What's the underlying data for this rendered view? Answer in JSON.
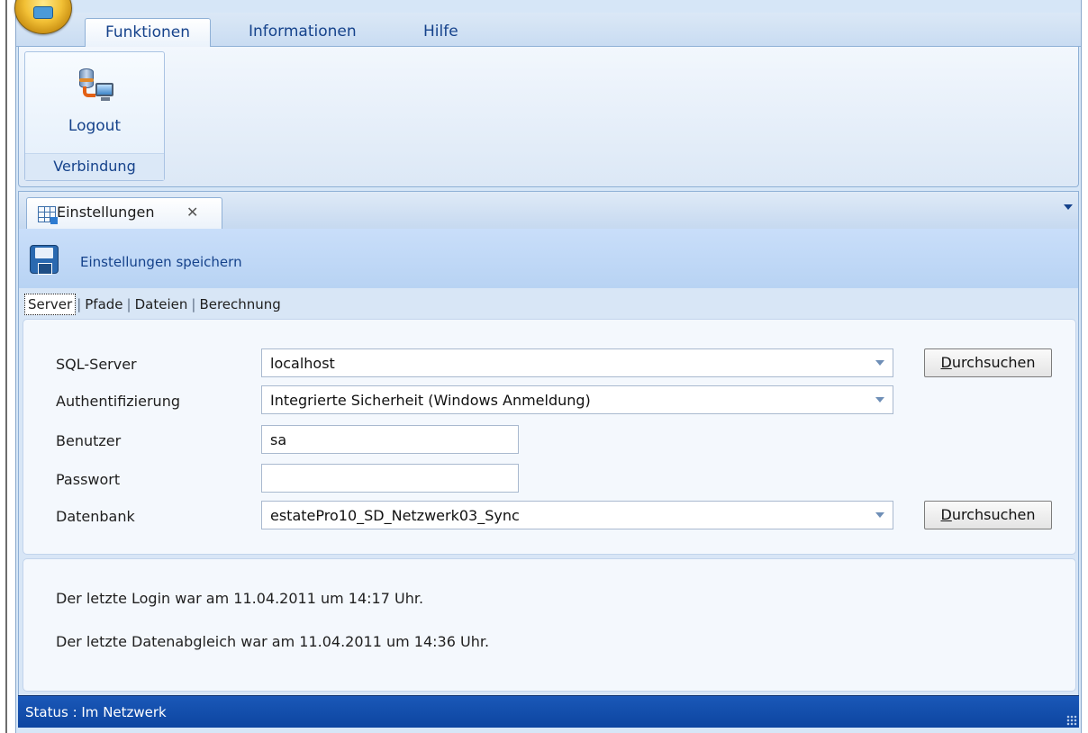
{
  "ribbon": {
    "tabs": [
      "Funktionen",
      "Informationen",
      "Hilfe"
    ],
    "active_tab": "Funktionen",
    "group": {
      "label": "Verbindung",
      "button_label": "Logout"
    }
  },
  "document_tab": {
    "label": "Einstellungen",
    "close_glyph": "✕"
  },
  "toolbar": {
    "save_label": "Einstellungen speichern"
  },
  "subtabs": {
    "items": [
      "Server",
      "Pfade",
      "Dateien",
      "Berechnung"
    ],
    "active": "Server"
  },
  "form": {
    "sql_server": {
      "label": "SQL-Server",
      "value": "localhost",
      "button_prefix": "D",
      "button_rest": "urchsuchen"
    },
    "auth": {
      "label": "Authentifizierung",
      "value": "Integrierte Sicherheit (Windows Anmeldung)"
    },
    "user": {
      "label": "Benutzer",
      "value": "sa"
    },
    "password": {
      "label": "Passwort",
      "value": ""
    },
    "database": {
      "label": "Datenbank",
      "value": "estatePro10_SD_Netzwerk03_Sync",
      "button_prefix": "D",
      "button_rest": "urchsuchen"
    }
  },
  "info": {
    "last_login": "Der letzte Login war am 11.04.2011 um 14:17 Uhr.",
    "last_sync": "Der letzte Datenabgleich war am 11.04.2011 um 14:36 Uhr."
  },
  "status": {
    "text": "Status : Im Netzwerk"
  },
  "colors": {
    "accent": "#15428b",
    "statusbar": "#0d45a0",
    "ribbon_bg": "#d6e6f7"
  },
  "icons": [
    "app-orb-icon",
    "logout-icon",
    "grid-icon",
    "close-icon",
    "save-icon",
    "chevron-down-icon",
    "resize-grip-icon"
  ]
}
